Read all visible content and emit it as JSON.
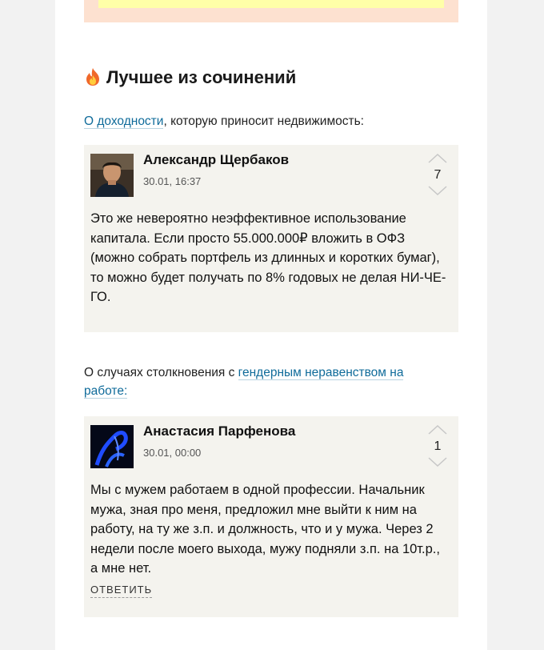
{
  "section": {
    "title": "Лучшее из сочинений",
    "icon": "fire-icon"
  },
  "comment_blocks": [
    {
      "intro_link": "О доходности",
      "intro_text": ", которую приносит недвижимость:",
      "author": "Александр Щербаков",
      "date": "30.01, 16:37",
      "votes": "7",
      "text": "Это же невероятно неэффективное использование капитала. Если просто 55.000.000₽ вложить в ОФЗ (можно собрать портфель из длинных и коротких бумаг), то можно будет получать по 8% годовых не делая НИ-ЧЕ-ГО."
    },
    {
      "intro_text": "О случаях столкновения с ",
      "intro_link": "гендерным неравенством на работе:",
      "author": "Анастасия Парфенова",
      "date": "30.01, 00:00",
      "votes": "1",
      "text": "Мы с мужем работаем в одной профессии. Начальник мужа, зная про меня, предложил мне выйти к ним на работу, на ту же з.п. и должность, что и у мужа. Через 2 недели после моего выхода, мужу подняли з.п. на 10т.р., а мне нет.",
      "reply_label": "ОТВЕТИТЬ"
    }
  ],
  "colors": {
    "link": "#0f6b9a",
    "comment_bg": "#f4f3ee",
    "promo_bg": "#fde1d0",
    "promo_inner": "#ffffa8"
  }
}
